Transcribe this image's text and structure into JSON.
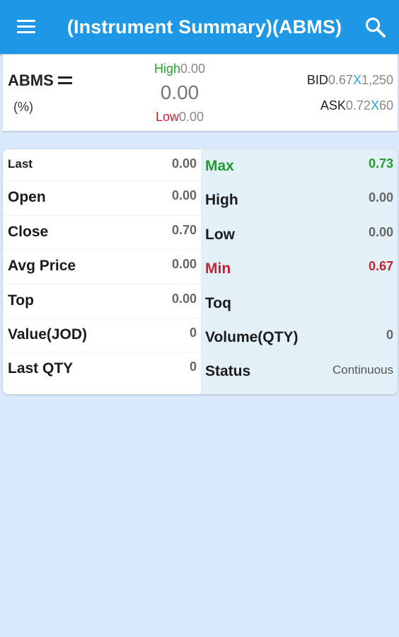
{
  "appbar": {
    "title": "(Instrument Summary)(ABMS)"
  },
  "summary": {
    "symbol": "ABMS",
    "percent": "(%)",
    "high_label": "High",
    "high_value": "0.00",
    "change": "0.00",
    "low_label": "Low",
    "low_value": "0.00",
    "bid_label": "BID",
    "bid_price": "0.67",
    "bid_x": "X",
    "bid_qty": "1,250",
    "ask_label": "ASK",
    "ask_price": "0.72",
    "ask_x": "X",
    "ask_qty": "60"
  },
  "details": {
    "left": [
      {
        "label": "Last",
        "value": "0.00"
      },
      {
        "label": "Open",
        "value": "0.00"
      },
      {
        "label": "Close",
        "value": "0.70"
      },
      {
        "label": "Avg Price",
        "value": "0.00"
      },
      {
        "label": "Top",
        "value": "0.00"
      },
      {
        "label": "Value(JOD)",
        "value": "0"
      },
      {
        "label": "Last QTY",
        "value": "0"
      }
    ],
    "right": [
      {
        "label": "Max",
        "value": "0.73"
      },
      {
        "label": "High",
        "value": "0.00"
      },
      {
        "label": "Low",
        "value": "0.00"
      },
      {
        "label": "Min",
        "value": "0.67"
      },
      {
        "label": "Toq",
        "value": ""
      },
      {
        "label": "Volume(QTY)",
        "value": "0"
      },
      {
        "label": "Status",
        "value": "Continuous"
      }
    ]
  },
  "colors": {
    "appbar": "#1e97e6",
    "background": "#d9e9fb",
    "positive": "#1f9c2c",
    "negative": "#c8202e",
    "accent_x": "#25a3e7"
  }
}
